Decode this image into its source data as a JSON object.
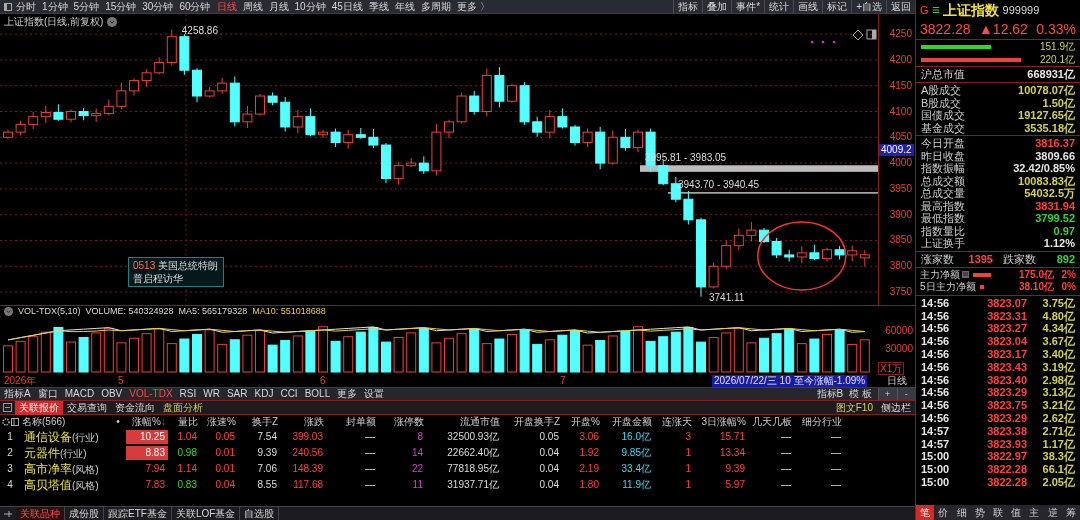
{
  "toolbar": {
    "periods": [
      {
        "label": "分时",
        "selected": false
      },
      {
        "label": "1分钟",
        "selected": false
      },
      {
        "label": "5分钟",
        "selected": false
      },
      {
        "label": "15分钟",
        "selected": false
      },
      {
        "label": "30分钟",
        "selected": false
      },
      {
        "label": "60分钟",
        "selected": false
      },
      {
        "label": "日线",
        "selected": true
      },
      {
        "label": "周线",
        "selected": false
      },
      {
        "label": "月线",
        "selected": false
      },
      {
        "label": "10分钟",
        "selected": false
      },
      {
        "label": "45日线",
        "selected": false
      },
      {
        "label": "季线",
        "selected": false
      },
      {
        "label": "年线",
        "selected": false
      },
      {
        "label": "多周期",
        "selected": false
      },
      {
        "label": "更多 〉",
        "selected": false
      }
    ],
    "tools": [
      "指标",
      "叠加",
      "事件*",
      "统计",
      "画线",
      "标记",
      "+自选",
      "返回"
    ]
  },
  "chart": {
    "title": "上证指数(日线,前复权)",
    "high_label": "4258.86",
    "low_label": "3741.11",
    "levels": [
      {
        "text": "3995.81 - 3983.05",
        "kind": "band"
      },
      {
        "text": "3943.70 - 3940.45",
        "kind": "line"
      }
    ],
    "price_tag": "4009.2",
    "event": {
      "code": "0513",
      "title": "美国总统特朗普启程访华"
    },
    "chart_data": {
      "type": "candlestick",
      "ylim": [
        3723,
        4289
      ],
      "grid": true,
      "yticks": [
        4250,
        4200,
        4150,
        4100,
        4050,
        4000,
        3950,
        3900,
        3850,
        3800,
        3750
      ],
      "ohlc": [
        [
          4050,
          4064,
          4047,
          4060
        ],
        [
          4060,
          4082,
          4054,
          4075
        ],
        [
          4075,
          4100,
          4066,
          4090
        ],
        [
          4090,
          4111,
          4078,
          4098
        ],
        [
          4098,
          4114,
          4082,
          4085
        ],
        [
          4085,
          4104,
          4079,
          4100
        ],
        [
          4100,
          4107,
          4083,
          4092
        ],
        [
          4092,
          4106,
          4080,
          4096
        ],
        [
          4096,
          4123,
          4093,
          4110
        ],
        [
          4110,
          4156,
          4104,
          4140
        ],
        [
          4140,
          4164,
          4131,
          4160
        ],
        [
          4160,
          4182,
          4148,
          4175
        ],
        [
          4175,
          4205,
          4172,
          4195
        ],
        [
          4195,
          4258.86,
          4189,
          4245
        ],
        [
          4245,
          4250,
          4171,
          4180
        ],
        [
          4180,
          4184,
          4118,
          4130
        ],
        [
          4130,
          4147,
          4127,
          4140
        ],
        [
          4140,
          4165,
          4134,
          4155
        ],
        [
          4155,
          4168,
          4071,
          4080
        ],
        [
          4080,
          4111,
          4068,
          4095
        ],
        [
          4095,
          4134,
          4092,
          4130
        ],
        [
          4130,
          4137,
          4112,
          4118
        ],
        [
          4118,
          4128,
          4061,
          4070
        ],
        [
          4070,
          4103,
          4058,
          4090
        ],
        [
          4090,
          4106,
          4052,
          4055
        ],
        [
          4055,
          4064,
          4049,
          4060
        ],
        [
          4060,
          4067,
          4031,
          4040
        ],
        [
          4040,
          4065,
          4028,
          4055
        ],
        [
          4055,
          4068,
          4047,
          4050
        ],
        [
          4050,
          4066,
          4029,
          4035
        ],
        [
          4035,
          4039,
          3961,
          3970
        ],
        [
          3970,
          4002,
          3958,
          3995
        ],
        [
          3995,
          4010,
          3992,
          4000
        ],
        [
          4000,
          4013,
          3979,
          3985
        ],
        [
          3985,
          4076,
          3976,
          4060
        ],
        [
          4060,
          4084,
          4048,
          4080
        ],
        [
          4080,
          4137,
          4077,
          4130
        ],
        [
          4130,
          4140,
          4094,
          4100
        ],
        [
          4100,
          4183,
          4091,
          4170
        ],
        [
          4170,
          4186,
          4108,
          4120
        ],
        [
          4120,
          4154,
          4117,
          4150
        ],
        [
          4150,
          4157,
          4074,
          4080
        ],
        [
          4080,
          4090,
          4051,
          4060
        ],
        [
          4060,
          4103,
          4048,
          4090
        ],
        [
          4090,
          4106,
          4067,
          4070
        ],
        [
          4070,
          4074,
          4034,
          4040
        ],
        [
          4040,
          4067,
          4031,
          4060
        ],
        [
          4060,
          4070,
          3988,
          4000
        ],
        [
          4000,
          4063,
          3997,
          4050
        ],
        [
          4050,
          4066,
          4024,
          4030
        ],
        [
          4030,
          4064,
          4021,
          4060
        ],
        [
          4060,
          4067,
          3983,
          3995
        ],
        [
          3995,
          4005,
          3957,
          3960
        ],
        [
          3960,
          3973,
          3924,
          3930
        ],
        [
          3930,
          3946,
          3881,
          3890
        ],
        [
          3890,
          3894,
          3741.11,
          3760
        ],
        [
          3760,
          3807,
          3757,
          3800
        ],
        [
          3800,
          3850,
          3794,
          3840
        ],
        [
          3840,
          3873,
          3831,
          3860
        ],
        [
          3860,
          3886,
          3848,
          3870
        ],
        [
          3870,
          3874,
          3845,
          3848
        ],
        [
          3848,
          3855,
          3816,
          3822
        ],
        [
          3822,
          3832,
          3809,
          3818
        ],
        [
          3818,
          3839,
          3806,
          3826
        ],
        [
          3826,
          3842,
          3812,
          3815
        ],
        [
          3815,
          3836,
          3809,
          3832
        ],
        [
          3832,
          3839,
          3813,
          3822
        ],
        [
          3822,
          3840,
          3810,
          3830
        ],
        [
          3816.37,
          3831.94,
          3799.52,
          3822.28
        ]
      ]
    }
  },
  "volume": {
    "title": "VOL-TDX(5,10)",
    "volume": "VOLUME: 540324928",
    "ma5": "MA5: 565179328",
    "ma10": "MA10: 551018688",
    "yticks": [
      "60000",
      "30000"
    ],
    "unit": "X1万",
    "dates": [
      "2026年",
      "5",
      "6",
      "7"
    ],
    "cursor": "2026/07/22/三 10 至今涨幅-1.09%",
    "period": "日线"
  },
  "indicators": {
    "tabs": [
      {
        "label": "指标A",
        "selected": false
      },
      {
        "label": "窗口",
        "selected": false
      },
      {
        "label": "MACD",
        "selected": false
      },
      {
        "label": "OBV",
        "selected": false
      },
      {
        "label": "VOL-TDX",
        "selected": true
      },
      {
        "label": "RSI",
        "selected": false
      },
      {
        "label": "WR",
        "selected": false
      },
      {
        "label": "SAR",
        "selected": false
      },
      {
        "label": "KDJ",
        "selected": false
      },
      {
        "label": "CCI",
        "selected": false
      },
      {
        "label": "BOLL",
        "selected": false
      },
      {
        "label": "更多",
        "selected": false
      },
      {
        "label": "设置",
        "selected": false
      }
    ],
    "right": [
      "指标B",
      "模 板"
    ],
    "zoom": [
      "+",
      "-"
    ]
  },
  "panel": {
    "tabs": [
      {
        "label": "关联报价",
        "selected": true
      },
      {
        "label": "交易查询",
        "selected": false
      },
      {
        "label": "资金流向",
        "selected": false
      },
      {
        "label": "盘面分析",
        "selected": false
      }
    ],
    "links": [
      "图文F10",
      "侧边栏"
    ]
  },
  "table": {
    "columns": [
      {
        "label": "名称(566)"
      },
      {
        "label": "•"
      },
      {
        "label": "涨幅%",
        "sort_mark": "↓"
      },
      {
        "label": "量比"
      },
      {
        "label": "涨速%"
      },
      {
        "label": "换手Z"
      },
      {
        "label": "涨跌"
      },
      {
        "label": "封单额"
      },
      {
        "label": "涨停数"
      },
      {
        "label": "流通市值"
      },
      {
        "label": "开盘换手Z"
      },
      {
        "label": "开盘%"
      },
      {
        "label": "开盘金额"
      },
      {
        "label": "连涨天"
      },
      {
        "label": "3日涨幅%"
      },
      {
        "label": "几天几板"
      },
      {
        "label": "细分行业"
      }
    ],
    "rows": [
      {
        "index": "1",
        "name": "通信设备",
        "tag": "(行业)",
        "change": "10.25",
        "limit_up": true,
        "vol_ratio": "1.04",
        "vol_ratio_up": true,
        "speed": "0.05",
        "turnover": "7.54",
        "points": "399.03",
        "seal": "—",
        "limit_count": "8",
        "float_cap": "32500.93亿",
        "open_turnover": "0.05",
        "open_pct": "3.06",
        "open_amount": "16.0亿",
        "streak": "3",
        "three_day": "15.71",
        "boards": "—",
        "industry": "—"
      },
      {
        "index": "2",
        "name": "元器件",
        "tag": "(行业)",
        "change": "8.83",
        "limit_up": true,
        "vol_ratio": "0.98",
        "vol_ratio_up": false,
        "speed": "0.01",
        "turnover": "9.39",
        "points": "240.56",
        "seal": "—",
        "limit_count": "14",
        "float_cap": "22662.40亿",
        "open_turnover": "0.04",
        "open_pct": "1.92",
        "open_amount": "9.85亿",
        "streak": "1",
        "three_day": "13.34",
        "boards": "—",
        "industry": "—"
      },
      {
        "index": "3",
        "name": "高市净率",
        "tag": "(风格)",
        "change": "7.94",
        "limit_up": false,
        "vol_ratio": "1.14",
        "vol_ratio_up": true,
        "speed": "0.01",
        "turnover": "7.06",
        "points": "148.39",
        "seal": "—",
        "limit_count": "22",
        "float_cap": "77818.95亿",
        "open_turnover": "0.04",
        "open_pct": "2.19",
        "open_amount": "33.4亿",
        "streak": "1",
        "three_day": "9.39",
        "boards": "—",
        "industry": "—"
      },
      {
        "index": "4",
        "name": "高贝塔值",
        "tag": "(风格)",
        "change": "7.83",
        "limit_up": false,
        "vol_ratio": "0.83",
        "vol_ratio_up": false,
        "speed": "0.04",
        "turnover": "8.55",
        "points": "117.68",
        "seal": "—",
        "limit_count": "11",
        "float_cap": "31937.71亿",
        "open_turnover": "0.04",
        "open_pct": "1.80",
        "open_amount": "11.9亿",
        "streak": "1",
        "three_day": "5.97",
        "boards": "—",
        "industry": "—"
      }
    ]
  },
  "bottom_tabs": [
    {
      "label": "关联品种",
      "selected": true
    },
    {
      "label": "成份股",
      "selected": false
    },
    {
      "label": "跟踪ETF基金",
      "selected": false
    },
    {
      "label": "关联LOF基金",
      "selected": false
    },
    {
      "label": "自选股",
      "selected": false
    }
  ],
  "quote": {
    "market": "G",
    "name": "上证指数",
    "code": "999999",
    "price": "3822.28",
    "change": "▲12.62",
    "pct": "0.33%"
  },
  "flows": [
    {
      "value": "151.9亿",
      "kind": "inflow"
    },
    {
      "value": "220.1亿",
      "kind": "outflow"
    }
  ],
  "market_value": {
    "label": "沪总市值",
    "value": "668931亿"
  },
  "turnover": [
    {
      "label": "A股成交",
      "value": "10078.07亿",
      "color": "#d4d44a"
    },
    {
      "label": "B股成交",
      "value": "1.50亿",
      "color": "#d4d44a"
    },
    {
      "label": "国债成交",
      "value": "19127.65亿",
      "color": "#d4d44a"
    },
    {
      "label": "基金成交",
      "value": "3535.18亿",
      "color": "#d4d44a"
    }
  ],
  "stats": [
    {
      "label": "今日开盘",
      "value": "3816.37",
      "color": "#ff4040"
    },
    {
      "label": "昨日收盘",
      "value": "3809.66",
      "color": "#e6e6e6"
    },
    {
      "label": "指数振幅",
      "value": "32.42/0.85%",
      "color": "#e6e6e6"
    },
    {
      "label": "总成交额",
      "value": "10083.83亿",
      "color": "#d4d44a"
    },
    {
      "label": "总成交量",
      "value": "54032.5万",
      "color": "#d4d44a"
    },
    {
      "label": "最高指数",
      "value": "3831.94",
      "color": "#ff4040"
    },
    {
      "label": "最低指数",
      "value": "3799.52",
      "color": "#3ad13a"
    },
    {
      "label": "指数量比",
      "value": "0.97",
      "color": "#3ad13a"
    },
    {
      "label": "上证换手",
      "value": "1.12%",
      "color": "#e6e6e6"
    }
  ],
  "breadth": {
    "up_label": "涨家数",
    "up": "1395",
    "down_label": "跌家数",
    "down": "892"
  },
  "main_flows": [
    {
      "label": "主力净额",
      "value": "175.0亿",
      "pct": "2%"
    },
    {
      "label": "5日主力净额",
      "value": "38.10亿",
      "pct": "0%"
    }
  ],
  "trades": [
    {
      "time": "14:56",
      "price": "3823.07",
      "amount": "3.75亿"
    },
    {
      "time": "14:56",
      "price": "3823.31",
      "amount": "4.80亿"
    },
    {
      "time": "14:56",
      "price": "3823.27",
      "amount": "4.34亿"
    },
    {
      "time": "14:56",
      "price": "3823.04",
      "amount": "3.67亿"
    },
    {
      "time": "14:56",
      "price": "3823.17",
      "amount": "3.40亿"
    },
    {
      "time": "14:56",
      "price": "3823.43",
      "amount": "3.19亿"
    },
    {
      "time": "14:56",
      "price": "3823.40",
      "amount": "2.98亿"
    },
    {
      "time": "14:56",
      "price": "3823.29",
      "amount": "3.13亿"
    },
    {
      "time": "14:56",
      "price": "3823.75",
      "amount": "3.21亿"
    },
    {
      "time": "14:56",
      "price": "3823.29",
      "amount": "2.62亿"
    },
    {
      "time": "14:57",
      "price": "3823.38",
      "amount": "2.71亿"
    },
    {
      "time": "14:57",
      "price": "3823.93",
      "amount": "1.17亿"
    },
    {
      "time": "15:00",
      "price": "3822.97",
      "amount": "38.3亿"
    },
    {
      "time": "15:00",
      "price": "3822.28",
      "amount": "66.1亿"
    },
    {
      "time": "15:00",
      "price": "3822.28",
      "amount": "2.05亿"
    }
  ],
  "side_tabs": [
    {
      "label": "笔",
      "selected": true
    },
    {
      "label": "价",
      "selected": false
    },
    {
      "label": "细",
      "selected": false
    },
    {
      "label": "势",
      "selected": false
    },
    {
      "label": "联",
      "selected": false
    },
    {
      "label": "值",
      "selected": false
    },
    {
      "label": "主",
      "selected": false
    },
    {
      "label": "逆",
      "selected": false
    },
    {
      "label": "筹",
      "selected": false
    }
  ]
}
